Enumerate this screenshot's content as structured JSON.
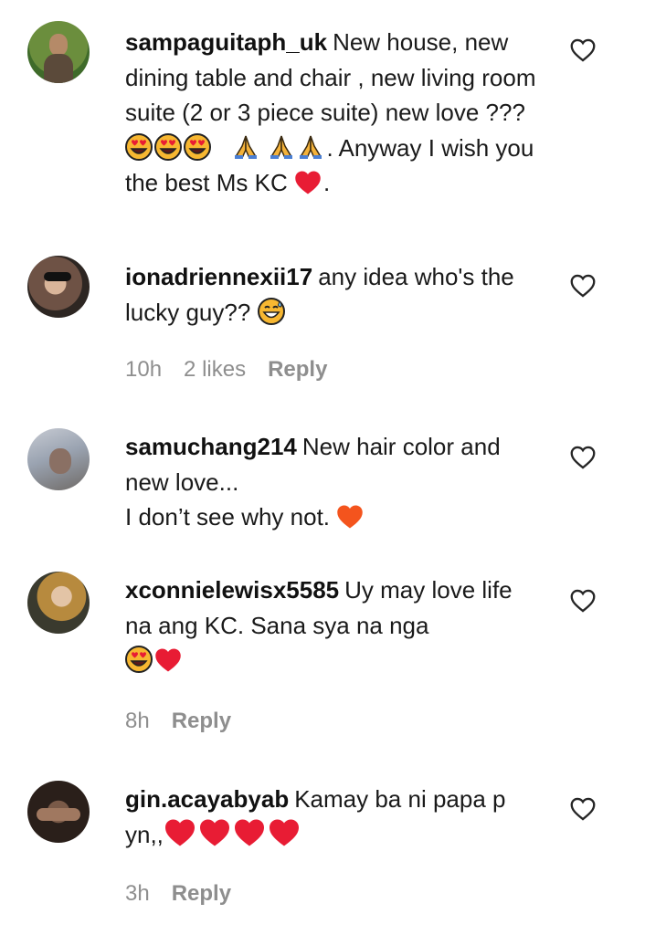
{
  "colors": {
    "heart_red": "#e81c34",
    "heart_orange": "#f4541d",
    "emoji_face": "#f7b731",
    "muted": "#8e8e8e"
  },
  "comments": [
    {
      "username": "sampaguitaph_uk",
      "text_1": "New house, new dining table and chair , new living room suite (2 or 3 piece suite) new love ???",
      "text_2": ". Anyway I wish you the best Ms KC",
      "text_3": "."
    },
    {
      "username": "ionadriennexii17",
      "text_1": "any idea who's the lucky guy??",
      "time": "10h",
      "likes": "2 likes",
      "reply": "Reply"
    },
    {
      "username": "samuchang214",
      "text_1": "New hair color and new love...",
      "text_2": "I don’t see why not."
    },
    {
      "username": "xconnielewisx5585",
      "text_1": "Uy may love life na ang KC. Sana sya na nga",
      "time": "8h",
      "reply": "Reply"
    },
    {
      "username": "gin.acayabyab",
      "text_1": "Kamay ba ni papa p yn,,",
      "time": "3h",
      "reply": "Reply"
    }
  ]
}
